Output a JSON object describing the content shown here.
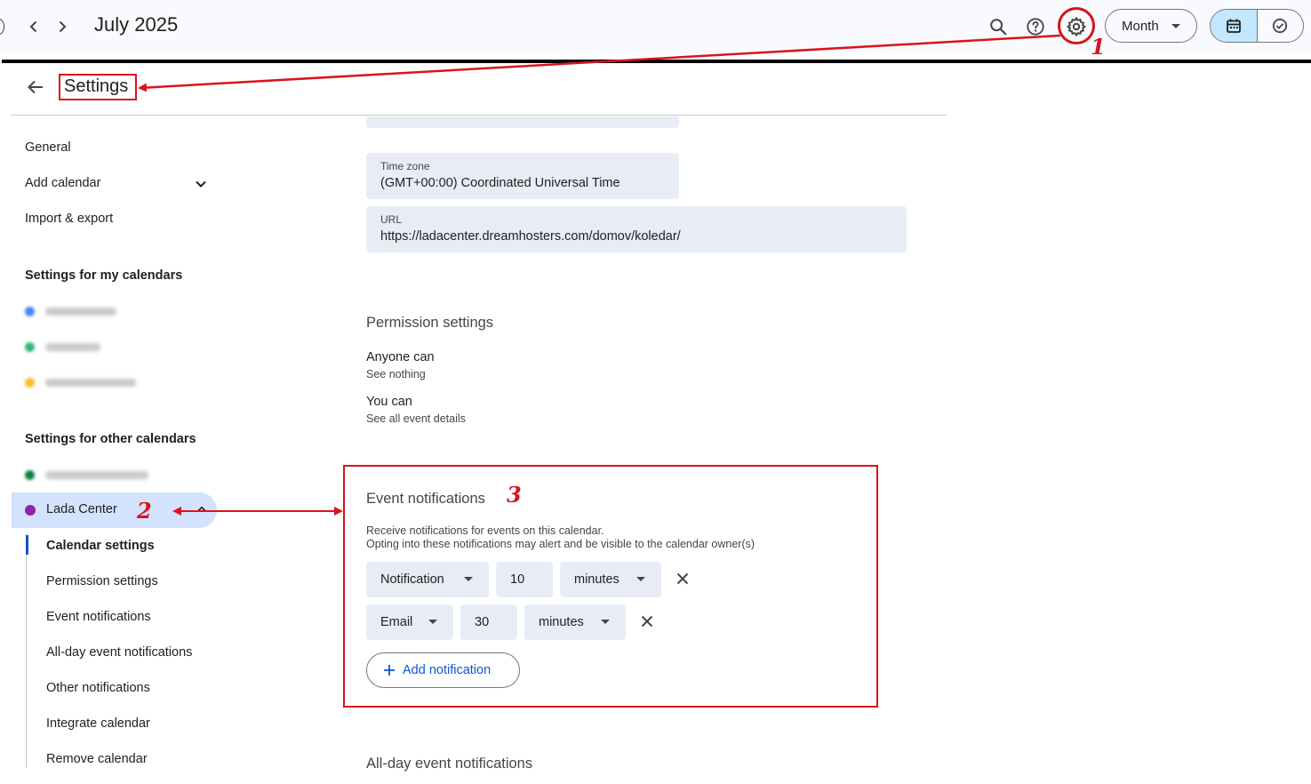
{
  "topbar": {
    "title": "July 2025",
    "view_label": "Month",
    "icons": [
      "chevron-left-icon",
      "chevron-right-icon",
      "search-icon",
      "help-icon",
      "gear-icon",
      "calendar-icon",
      "task-check-icon"
    ]
  },
  "settings": {
    "title": "Settings"
  },
  "sidebar": {
    "general": "General",
    "add_calendar": "Add calendar",
    "import_export": "Import & export",
    "my_calendars_heading": "Settings for my calendars",
    "other_calendars_heading": "Settings for other calendars",
    "selected_calendar": "Lada Center",
    "selected_calendar_color": "#8e24aa",
    "sub_items": [
      "Calendar settings",
      "Permission settings",
      "Event notifications",
      "All-day event notifications",
      "Other notifications",
      "Integrate calendar",
      "Remove calendar"
    ]
  },
  "main": {
    "time_zone": {
      "label": "Time zone",
      "value": "(GMT+00:00) Coordinated Universal Time"
    },
    "url": {
      "label": "URL",
      "value": "https://ladacenter.dreamhosters.com/domov/koledar/"
    },
    "permission_settings": {
      "title": "Permission settings",
      "anyone_label": "Anyone can",
      "anyone_value": "See nothing",
      "you_label": "You can",
      "you_value": "See all event details"
    },
    "event_notifications": {
      "title": "Event notifications",
      "description_1": "Receive notifications for events on this calendar.",
      "description_2": "Opting into these notifications may alert and be visible to the calendar owner(s)",
      "rows": [
        {
          "type": "Notification",
          "amount": "10",
          "unit": "minutes"
        },
        {
          "type": "Email",
          "amount": "30",
          "unit": "minutes"
        }
      ],
      "add_label": "Add notification"
    },
    "all_day_title": "All-day event notifications"
  },
  "annotations": {
    "color": "#d9141c",
    "labels": [
      "1",
      "2",
      "3"
    ]
  }
}
